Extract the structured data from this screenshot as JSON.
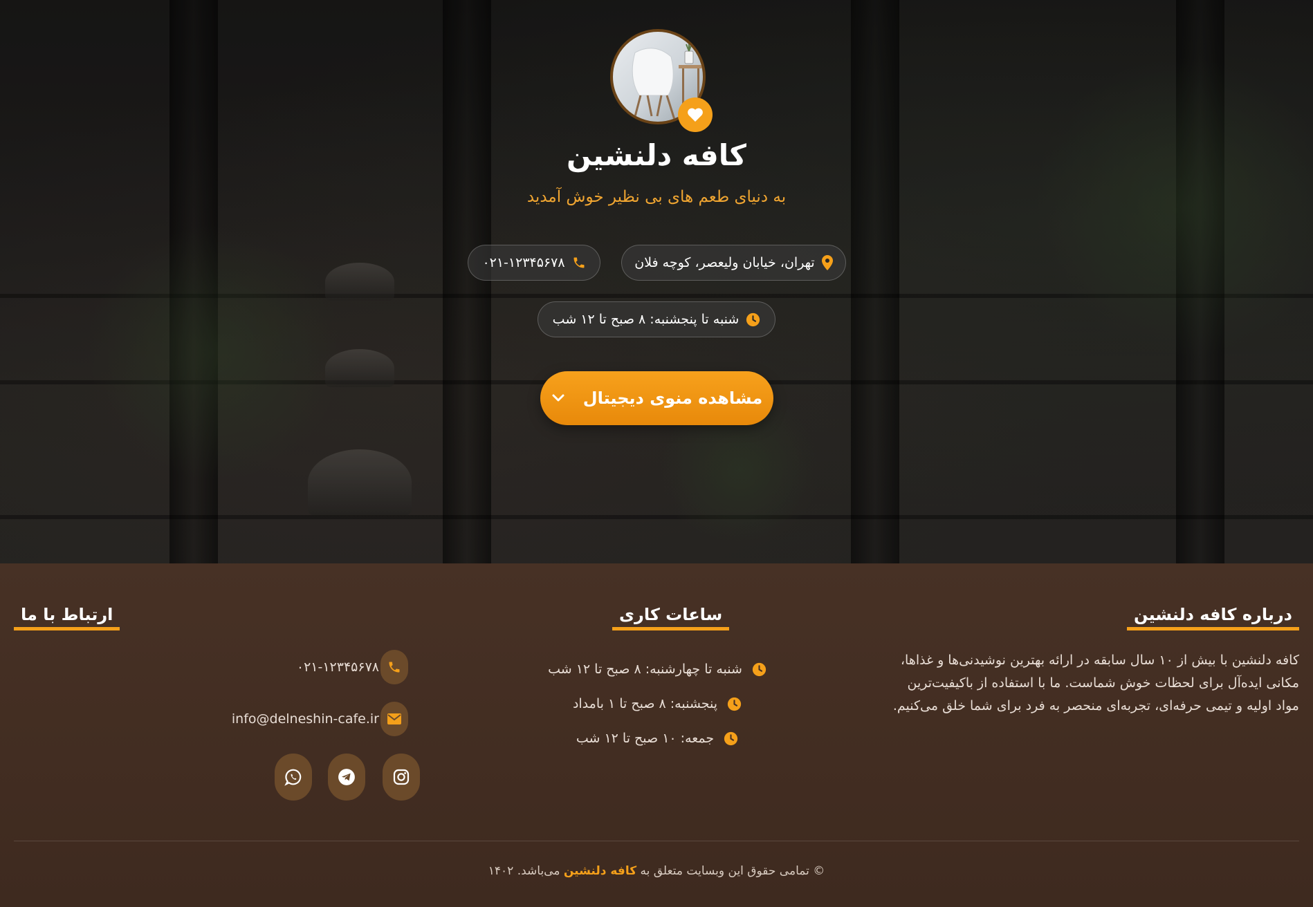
{
  "hero": {
    "title": "کافه دلنشین",
    "subtitle": "به دنیای طعم های بی نظیر خوش آمدید",
    "address": "تهران، خیابان ولیعصر، کوچه فلان",
    "phone": "۰۲۱-۱۲۳۴۵۶۷۸",
    "hours": "شنبه تا پنجشنبه: ۸ صبح تا ۱۲ شب",
    "menu_button": "مشاهده منوی دیجیتال"
  },
  "footer": {
    "about": {
      "heading": "درباره کافه دلنشین",
      "text": "کافه دلنشین با بیش از ۱۰ سال سابقه در ارائه بهترین نوشیدنی‌ها و غذاها، مکانی ایده‌آل برای لحظات خوش شماست. ما با استفاده از باکیفیت‌ترین مواد اولیه و تیمی حرفه‌ای، تجربه‌ای منحصر به فرد برای شما خلق می‌کنیم."
    },
    "hours": {
      "heading": "ساعات کاری",
      "items": [
        "شنبه تا چهارشنبه: ۸ صبح تا ۱۲ شب",
        "پنجشنبه: ۸ صبح تا ۱ بامداد",
        "جمعه: ۱۰ صبح تا ۱۲ شب"
      ]
    },
    "contact": {
      "heading": "ارتباط با ما",
      "phone": "۰۲۱-۱۲۳۴۵۶۷۸",
      "email": "info@delneshin-cafe.ir"
    },
    "social": [
      "instagram-icon",
      "telegram-icon",
      "whatsapp-icon"
    ],
    "copyright": {
      "prefix": "© تمامی حقوق این وبسایت متعلق به",
      "brand": "کافه دلنشین",
      "suffix": "می‌باشد. ۱۴۰۲"
    }
  },
  "colors": {
    "accent": "#f5a01a",
    "footer_bg": "#3f2b20",
    "icon_bg": "#6b4a2a"
  }
}
